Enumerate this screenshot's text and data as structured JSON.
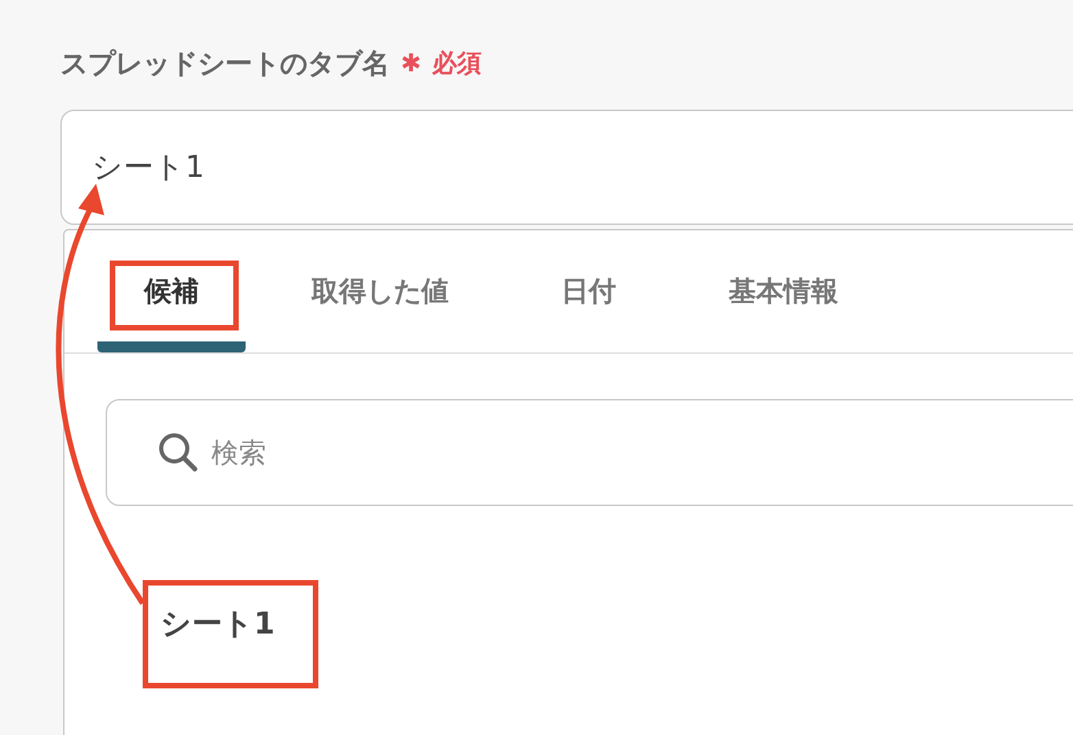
{
  "field": {
    "label": "スプレッドシートのタブ名",
    "required_mark": "✱",
    "required_text": "必須",
    "value": "シート1"
  },
  "tabs": [
    {
      "label": "候補",
      "selected": true
    },
    {
      "label": "取得した値",
      "selected": false
    },
    {
      "label": "日付",
      "selected": false
    },
    {
      "label": "基本情報",
      "selected": false
    }
  ],
  "search": {
    "placeholder": "検索"
  },
  "options": [
    {
      "label": "シート1"
    }
  ]
}
